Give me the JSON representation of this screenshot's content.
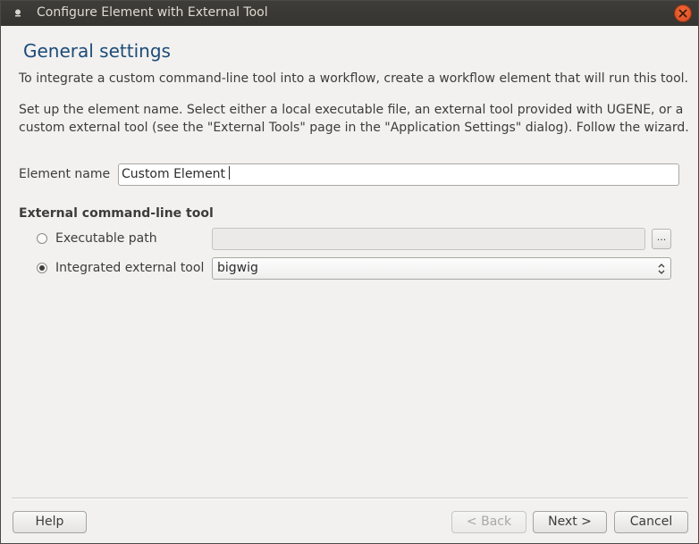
{
  "window": {
    "title": "Configure Element with External Tool",
    "menu_icon": "window-menu-icon",
    "close_icon": "close-icon"
  },
  "page": {
    "title": "General settings",
    "description1": "To integrate a custom command-line tool into a workflow, create a workflow element that will run this tool.",
    "description2": "Set up the element name. Select either a local executable file, an external tool provided with UGENE, or a custom external tool (see the \"External Tools\" page in the \"Application Settings\" dialog). Follow the wizard."
  },
  "element_name": {
    "label": "Element name",
    "value": "Custom Element"
  },
  "tool": {
    "section_label": "External command-line tool",
    "executable_label": "Executable path",
    "executable_value": "",
    "browse_label": "...",
    "integrated_label": "Integrated external tool",
    "integrated_selected": "bigwig",
    "selected_option": "integrated"
  },
  "buttons": {
    "help": "Help",
    "back": "< Back",
    "next": "Next >",
    "cancel": "Cancel"
  },
  "colors": {
    "title_accent": "#1c4b78",
    "titlebar": "#3e3d39",
    "close_button": "#e0562a",
    "background": "#f2f1f0"
  }
}
